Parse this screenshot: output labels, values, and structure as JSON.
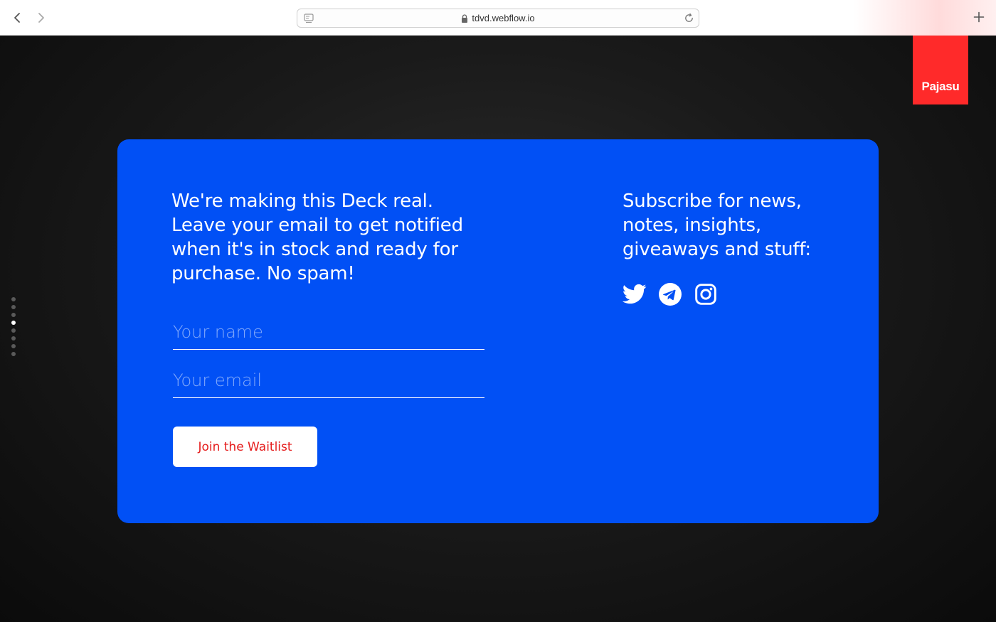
{
  "browser": {
    "url": "tdvd.webflow.io"
  },
  "brand": {
    "name": "Pajasu",
    "color": "#ff2a2a"
  },
  "pagination": {
    "count": 8,
    "active_index": 3
  },
  "card": {
    "background": "#0150f5",
    "intro_text": "We're making this Deck real. Leave your email to get notified when it's in stock and ready for purchase. No spam!",
    "name_placeholder": "Your name",
    "email_placeholder": "Your email",
    "join_button_label": "Join the Waitlist",
    "subscribe_text": "Subscribe for news, notes, insights, giveaways and stuff:",
    "social_icons": [
      "twitter-icon",
      "telegram-icon",
      "instagram-icon"
    ]
  }
}
